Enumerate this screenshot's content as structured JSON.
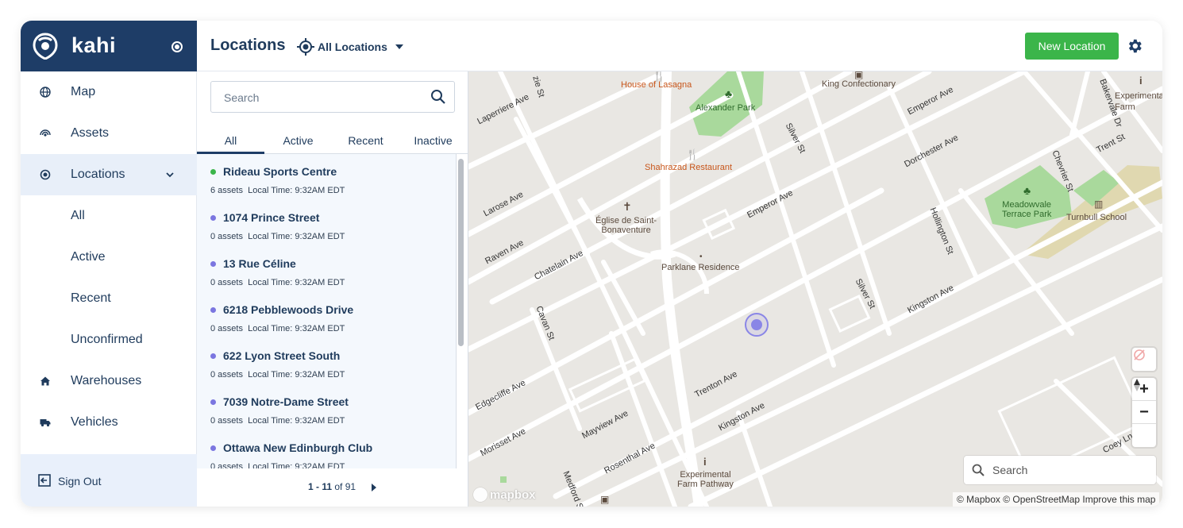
{
  "brand": {
    "name": "kahi"
  },
  "sidebar": {
    "items": [
      {
        "label": "Map",
        "icon": "globe-icon"
      },
      {
        "label": "Assets",
        "icon": "signal-icon"
      },
      {
        "label": "Locations",
        "icon": "target-icon"
      },
      {
        "label": "Warehouses",
        "icon": "home-icon"
      },
      {
        "label": "Vehicles",
        "icon": "truck-icon"
      }
    ],
    "sub_items": [
      "All",
      "Active",
      "Recent",
      "Unconfirmed"
    ],
    "sign_out": "Sign Out"
  },
  "header": {
    "title": "Locations",
    "filter": "All Locations",
    "new_button": "New Location"
  },
  "list": {
    "search_placeholder": "Search",
    "tabs": [
      "All",
      "Active",
      "Recent",
      "Inactive"
    ],
    "items": [
      {
        "name": "Rideau Sports Centre",
        "assets": "6 assets",
        "time": "Local Time: 9:32AM EDT",
        "status_color": "#3bb54a"
      },
      {
        "name": "1074 Prince Street",
        "assets": "0 assets",
        "time": "Local Time: 9:32AM EDT",
        "status_color": "#7b76e0"
      },
      {
        "name": "13 Rue Céline",
        "assets": "0 assets",
        "time": "Local Time: 9:32AM EDT",
        "status_color": "#7b76e0"
      },
      {
        "name": "6218 Pebblewoods Drive",
        "assets": "0 assets",
        "time": "Local Time: 9:32AM EDT",
        "status_color": "#7b76e0"
      },
      {
        "name": "622 Lyon Street South",
        "assets": "0 assets",
        "time": "Local Time: 9:32AM EDT",
        "status_color": "#7b76e0"
      },
      {
        "name": "7039 Notre-Dame Street",
        "assets": "0 assets",
        "time": "Local Time: 9:32AM EDT",
        "status_color": "#7b76e0"
      },
      {
        "name": "Ottawa New Edinburgh Club",
        "assets": "0 assets",
        "time": "Local Time: 9:32AM EDT",
        "status_color": "#7b76e0"
      }
    ],
    "pager": {
      "range": "1 - 11",
      "of": "of 91"
    }
  },
  "map": {
    "pois": {
      "lasagna": "House of Lasagna",
      "alexander": "Alexander Park",
      "confectionary": "King Confectionary",
      "experimental_top": "Experimental Farm Pathway",
      "shahrazad": "Shahrazad Restaurant",
      "eglise_1": "Église de Saint-",
      "eglise_2": "Bonaventure",
      "parklane": "Parklane Residence",
      "meadowvale_1": "Meadowvale",
      "meadowvale_2": "Terrace Park",
      "turnbull": "Turnbull School",
      "experimental_1": "Experimental",
      "experimental_2": "Farm Pathway"
    },
    "streets": {
      "laperriere": "Laperriere Ave",
      "larose": "Larose Ave",
      "raven": "Raven Ave",
      "chatelain": "Chatelain Ave",
      "cavan": "Cavan St",
      "edgecliffe": "Edgecliffe Ave",
      "morisset": "Morisset Ave",
      "mayview": "Mayview Ave",
      "rosenthal": "Rosenthal Ave",
      "medford": "Medford St",
      "trenton": "Trenton Ave",
      "kingston1": "Kingston Ave",
      "kingston2": "Kingston Ave",
      "emperor1": "Emperor Ave",
      "emperor2": "Emperor Ave",
      "dorchester": "Dorchester Ave",
      "silver1": "Silver St",
      "silver2": "Silver St",
      "hollington": "Hollington St",
      "chevrier": "Chevrier St",
      "trent": "Trent St",
      "bakervale": "Bakervale Dr",
      "mackenzie": "zie St",
      "coeyl": "Coey Ln"
    },
    "search_placeholder": "Search",
    "attribution": "© Mapbox © OpenStreetMap Improve this map",
    "logo": "mapbox",
    "zoom_in": "+",
    "zoom_out": "−"
  }
}
